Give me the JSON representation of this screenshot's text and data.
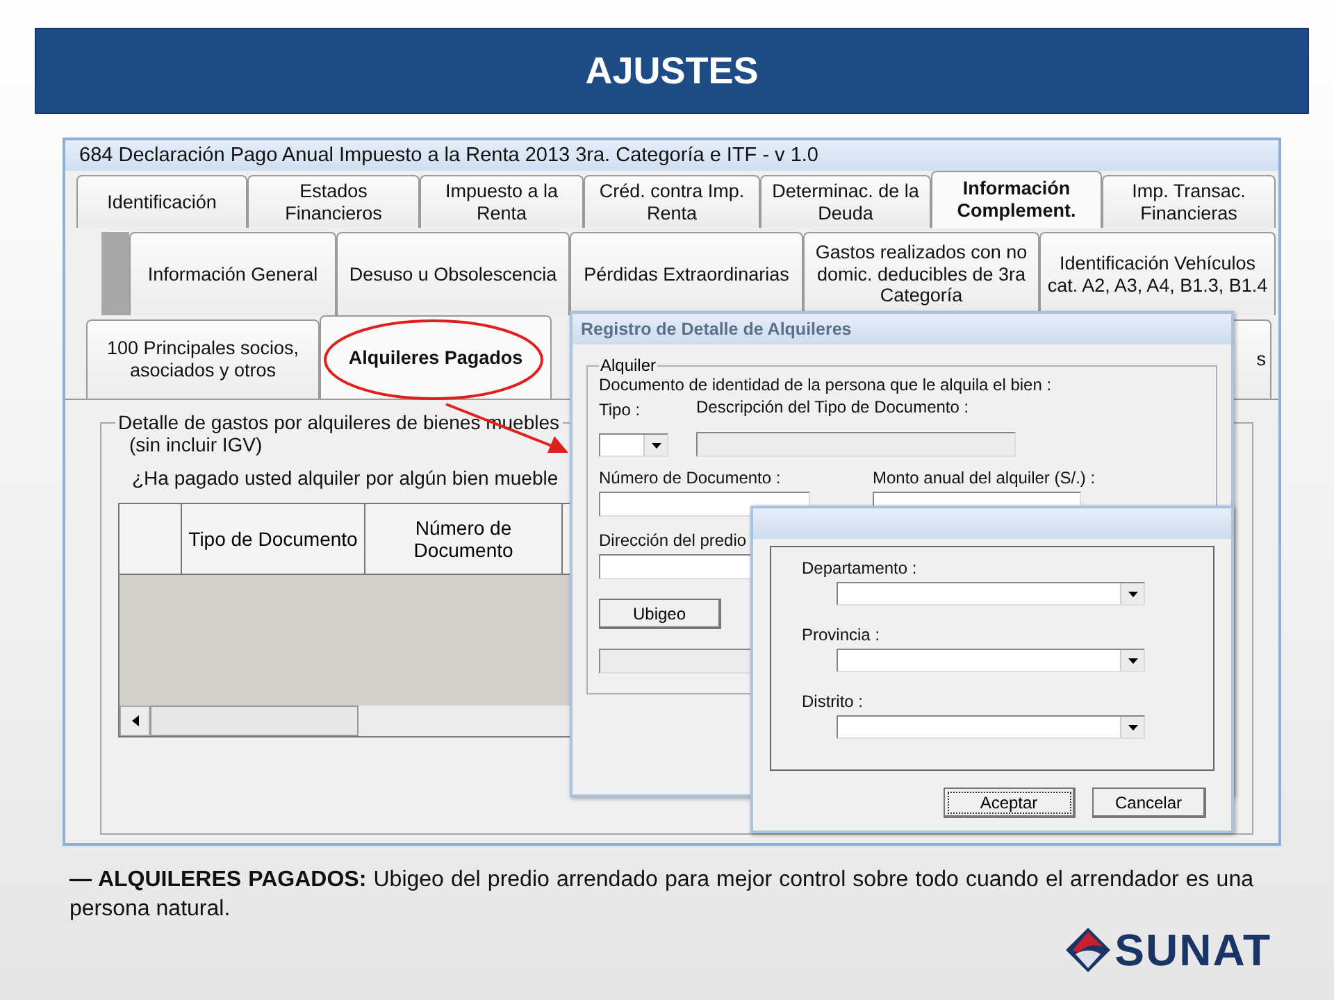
{
  "slide": {
    "title": "AJUSTES"
  },
  "window": {
    "title": "684 Declaración Pago Anual Impuesto a la Renta 2013 3ra. Categoría e ITF - v 1.0",
    "tabs": [
      {
        "label": "Identificación",
        "selected": false
      },
      {
        "label": "Estados Financieros",
        "selected": false
      },
      {
        "label": "Impuesto a la Renta",
        "selected": false
      },
      {
        "label": "Créd. contra Imp. Renta",
        "selected": false
      },
      {
        "label": "Determinac. de la Deuda",
        "selected": false
      },
      {
        "label": "Información Complement.",
        "selected": true
      },
      {
        "label": "Imp. Transac. Financieras",
        "selected": false
      }
    ],
    "subtabs": [
      {
        "label": "Información General",
        "selected": false
      },
      {
        "label": "Desuso u Obsolescencia",
        "selected": false
      },
      {
        "label": "Pérdidas Extraordinarias",
        "selected": false
      },
      {
        "label": "Gastos realizados con no domic. deducibles de 3ra Categoría",
        "selected": false
      },
      {
        "label": "Identificación Vehículos cat. A2, A3, A4, B1.3, B1.4",
        "selected": false
      }
    ],
    "section_tabs": [
      {
        "label": "100 Principales socios, asociados y otros",
        "selected": false
      },
      {
        "label": "Alquileres Pagados",
        "selected": true
      },
      {
        "label": "s",
        "selected": false
      }
    ],
    "group": {
      "title": "Detalle de gastos por alquileres de bienes muebles",
      "note": "(sin incluir IGV)",
      "question": "¿Ha pagado usted alquiler por algún bien mueble",
      "table": {
        "columns": [
          "Tipo de Documento",
          "Número de Documento"
        ]
      }
    }
  },
  "rental_dialog": {
    "title": "Registro de Detalle de Alquileres",
    "group_title": "Alquiler",
    "instruction": "Documento de identidad de la persona que le alquila el bien :",
    "type_label": "Tipo :",
    "description_label": "Descripción del Tipo de Documento :",
    "number_label": "Número de Documento :",
    "amount_label": "Monto anual del alquiler (S/.) :",
    "address_label": "Dirección del predio",
    "ubigeo_button": "Ubigeo"
  },
  "ubigeo_dialog": {
    "fields": [
      {
        "label": "Departamento :"
      },
      {
        "label": "Provincia :"
      },
      {
        "label": "Distrito :"
      }
    ],
    "buttons": [
      {
        "label": "Aceptar",
        "focused": true
      },
      {
        "label": "Cancelar",
        "focused": false
      }
    ]
  },
  "caption": "**— ALQUILERES PAGADOS:** Ubigeo del predio arrendado para mejor control sobre todo cuando el arrendador es una persona natural.",
  "logo": {
    "text": "SUNAT"
  }
}
